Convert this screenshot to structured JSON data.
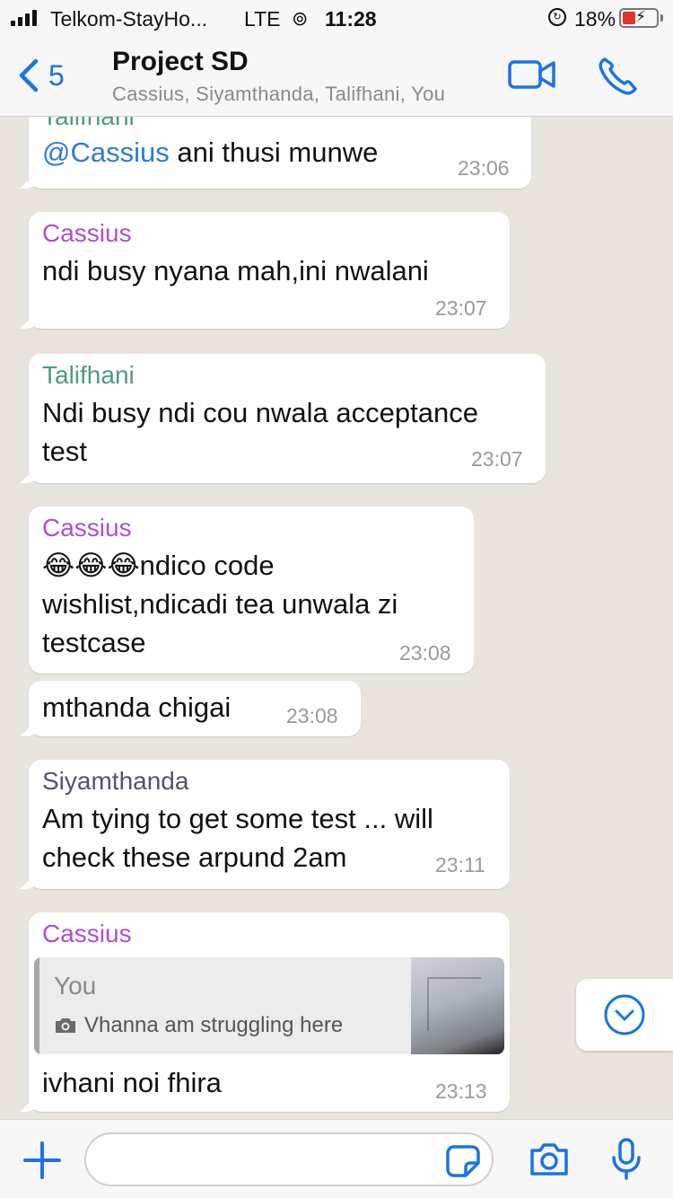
{
  "status_bar": {
    "carrier": "Telkom-StayHo...",
    "network": "LTE",
    "time": "11:28",
    "battery": "18%"
  },
  "header": {
    "back_count": "5",
    "title": "Project SD",
    "subtitle": "Cassius, Siyamthanda, Talifhani, You"
  },
  "messages": [
    {
      "sender": "Talifhani",
      "mention": "@Cassius",
      "text": " ani thusi munwe",
      "time": "23:06"
    },
    {
      "sender": "Cassius",
      "text": "ndi busy nyana mah,ini nwalani",
      "time": "23:07"
    },
    {
      "sender": "Talifhani",
      "line1": "Ndi busy ndi cou nwala acceptance",
      "line2": "test",
      "time": "23:07"
    },
    {
      "sender": "Cassius",
      "emoji": "😂😂😂",
      "line1": "ndico code",
      "line2": "wishlist,ndicadi tea unwala zi",
      "line3": "testcase",
      "time": "23:08"
    },
    {
      "text": "mthanda chigai",
      "time": "23:08"
    },
    {
      "sender": "Siyamthanda",
      "line1": "Am tying to get some test ... will",
      "line2": "check these arpund 2am",
      "time": "23:11"
    },
    {
      "sender": "Cassius",
      "quote_name": "You",
      "quote_text": "Vhanna am struggling here",
      "text": "ivhani noi fhira",
      "time": "23:13"
    }
  ],
  "input": {
    "placeholder": ""
  },
  "colors": {
    "accent": "#1a73e8",
    "sender_cassius": "#b04fd1",
    "sender_talifhani": "#4f9a86",
    "sender_siyamthanda": "#5b4f6a",
    "chat_bg": "#e9e4dc"
  },
  "icons": [
    "back-chevron-icon",
    "video-camera-icon",
    "phone-icon",
    "chevron-down-circle-icon",
    "plus-icon",
    "sticker-icon",
    "camera-icon",
    "microphone-icon",
    "photo-icon"
  ]
}
